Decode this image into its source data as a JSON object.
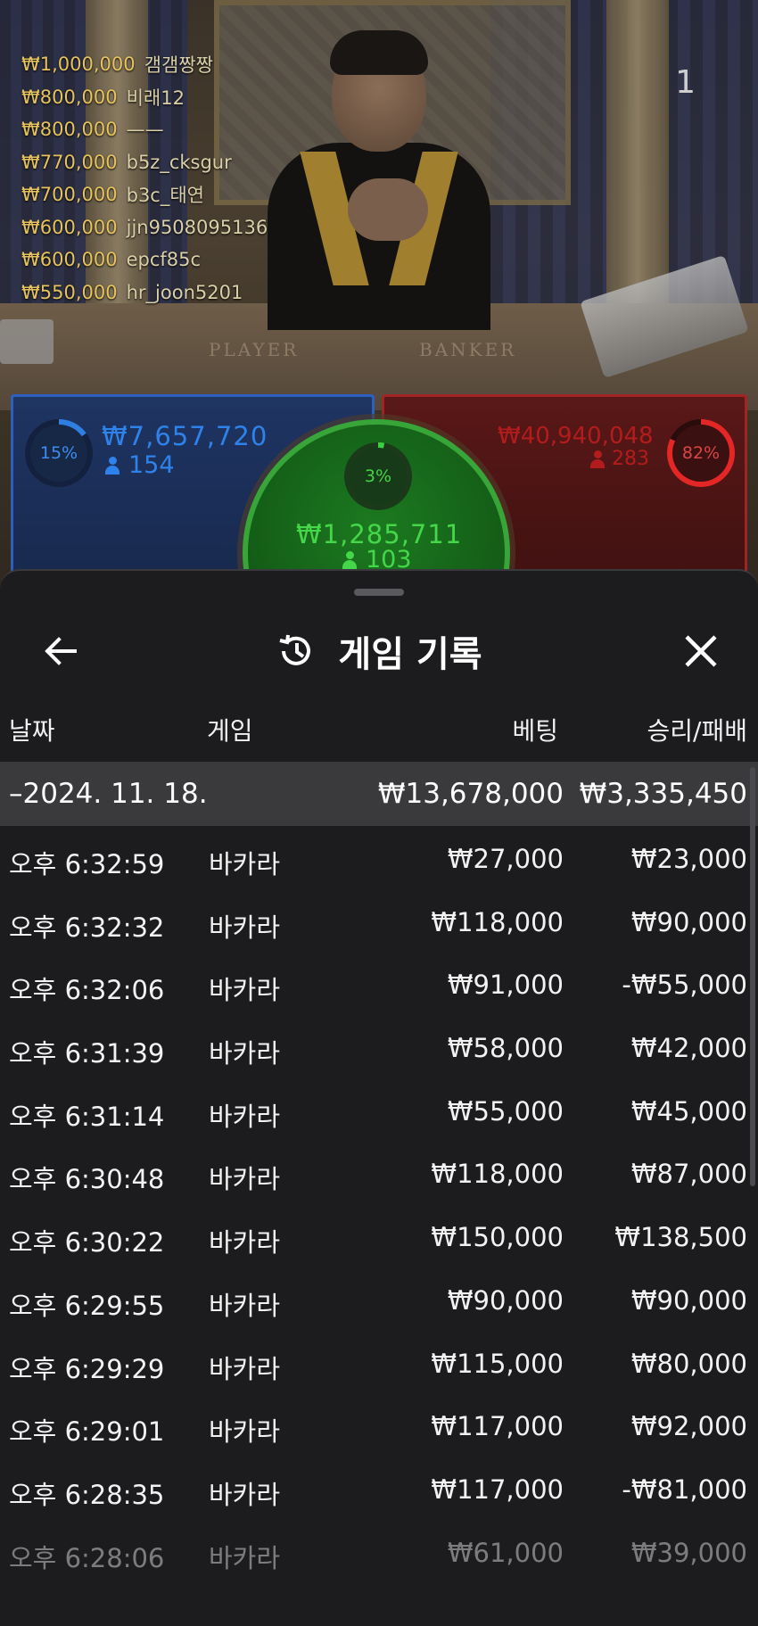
{
  "leaderboard": [
    {
      "amount": "₩1,000,000",
      "user": "갬갬짱짱"
    },
    {
      "amount": "₩800,000",
      "user": "비래12"
    },
    {
      "amount": "₩800,000",
      "user": "——"
    },
    {
      "amount": "₩770,000",
      "user": "b5z_cksgur"
    },
    {
      "amount": "₩700,000",
      "user": "b3c_태연"
    },
    {
      "amount": "₩600,000",
      "user": "jjn9508095136"
    },
    {
      "amount": "₩600,000",
      "user": "epcf85c"
    },
    {
      "amount": "₩550,000",
      "user": "hr_joon5201"
    }
  ],
  "stream": {
    "viewer_badge": "1",
    "table_left_label": "PLAYER",
    "table_right_label": "BANKER"
  },
  "bets": {
    "player": {
      "percent": "15%",
      "percent_value": 0.15,
      "amount": "₩7,657,720",
      "count": "154",
      "color": "#2f82ea"
    },
    "tie": {
      "percent": "3%",
      "percent_value": 0.03,
      "amount": "₩1,285,711",
      "count": "103",
      "color": "#45d64a"
    },
    "banker": {
      "percent": "82%",
      "percent_value": 0.82,
      "amount": "₩40,940,048",
      "count": "283",
      "color": "#b31c1c"
    }
  },
  "sheet": {
    "title": "게임 기록",
    "back_icon": "arrow-left-icon",
    "title_icon": "history-icon",
    "close_icon": "close-icon",
    "columns": {
      "date": "날짜",
      "game": "게임",
      "bet": "베팅",
      "result": "승리/패배"
    },
    "group": {
      "date": "–2024. 11. 18.",
      "bet_total": "₩13,678,000",
      "result_total": "₩3,335,450"
    },
    "rows": [
      {
        "time": "오후 6:32:59",
        "game": "바카라",
        "bet": "₩27,000",
        "result": "₩23,000"
      },
      {
        "time": "오후 6:32:32",
        "game": "바카라",
        "bet": "₩118,000",
        "result": "₩90,000"
      },
      {
        "time": "오후 6:32:06",
        "game": "바카라",
        "bet": "₩91,000",
        "result": "-₩55,000"
      },
      {
        "time": "오후 6:31:39",
        "game": "바카라",
        "bet": "₩58,000",
        "result": "₩42,000"
      },
      {
        "time": "오후 6:31:14",
        "game": "바카라",
        "bet": "₩55,000",
        "result": "₩45,000"
      },
      {
        "time": "오후 6:30:48",
        "game": "바카라",
        "bet": "₩118,000",
        "result": "₩87,000"
      },
      {
        "time": "오후 6:30:22",
        "game": "바카라",
        "bet": "₩150,000",
        "result": "₩138,500"
      },
      {
        "time": "오후 6:29:55",
        "game": "바카라",
        "bet": "₩90,000",
        "result": "₩90,000"
      },
      {
        "time": "오후 6:29:29",
        "game": "바카라",
        "bet": "₩115,000",
        "result": "₩80,000"
      },
      {
        "time": "오후 6:29:01",
        "game": "바카라",
        "bet": "₩117,000",
        "result": "₩92,000"
      },
      {
        "time": "오후 6:28:35",
        "game": "바카라",
        "bet": "₩117,000",
        "result": "-₩81,000"
      },
      {
        "time": "오후 6:28:06",
        "game": "바카라",
        "bet": "₩61,000",
        "result": "₩39,000"
      }
    ]
  }
}
